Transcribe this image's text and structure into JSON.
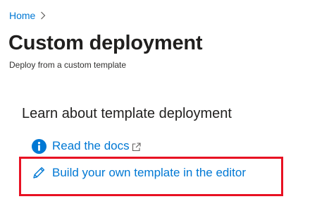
{
  "breadcrumb": {
    "items": [
      {
        "label": "Home"
      }
    ]
  },
  "header": {
    "title": "Custom deployment",
    "subtitle": "Deploy from a custom template"
  },
  "main": {
    "section_heading": "Learn about template deployment",
    "links": {
      "docs": {
        "label": "Read the docs",
        "icon": "info-icon",
        "trailing_icon": "external-link-icon"
      },
      "editor": {
        "label": "Build your own template in the editor",
        "icon": "pencil-icon"
      }
    }
  },
  "colors": {
    "link": "#0078d4",
    "text": "#201f1e",
    "highlight": "#e81123"
  }
}
